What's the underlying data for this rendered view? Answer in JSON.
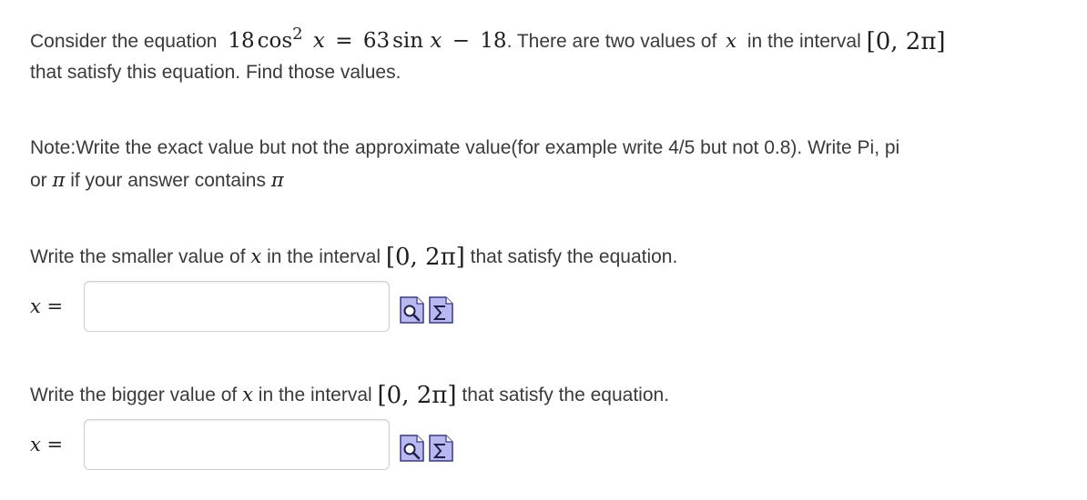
{
  "problem": {
    "intro_text": "Consider the equation",
    "eq_coef1": "18",
    "eq_cos": "cos",
    "eq_exp": "2",
    "eq_var": "x",
    "eq_equals": "=",
    "eq_coef2": "63",
    "eq_sin": "sin",
    "eq_minus": "−",
    "eq_const": "18",
    "after_eq": ". There are two values of",
    "var": "x",
    "in_interval_text": "in the interval",
    "interval": "[0, 2π]",
    "line2": "that satisfy this equation. Find those values."
  },
  "note": {
    "line1": "Note:Write the exact value but not the approximate value(for example write 4/5 but not 0.8). Write Pi, pi",
    "line2_prefix": "or",
    "pi_symbol": "π",
    "line2_middle": "if your answer contains",
    "pi_symbol_end": "π"
  },
  "question1": {
    "prefix": "Write the smaller value of",
    "var": "x",
    "middle": "in the interval",
    "interval": "[0, 2π]",
    "suffix": "that satisfy the equation.",
    "answer_label_var": "x",
    "answer_label_eq": "=",
    "answer_value": "",
    "answer_placeholder": ""
  },
  "question2": {
    "prefix": "Write the bigger value of",
    "var": "x",
    "middle": "in the interval",
    "interval": "[0, 2π]",
    "suffix": "that satisfy the equation.",
    "answer_label_var": "x",
    "answer_label_eq": "=",
    "answer_value": "",
    "answer_placeholder": ""
  },
  "icons": {
    "preview": "preview-icon",
    "equation_editor": "sigma-icon"
  },
  "colors": {
    "text": "#3a3a3a",
    "math": "#1f1f1f",
    "input_border": "#cfcfcf",
    "icon_fill": "#b9b9f2",
    "icon_border": "#3a3a7a"
  }
}
